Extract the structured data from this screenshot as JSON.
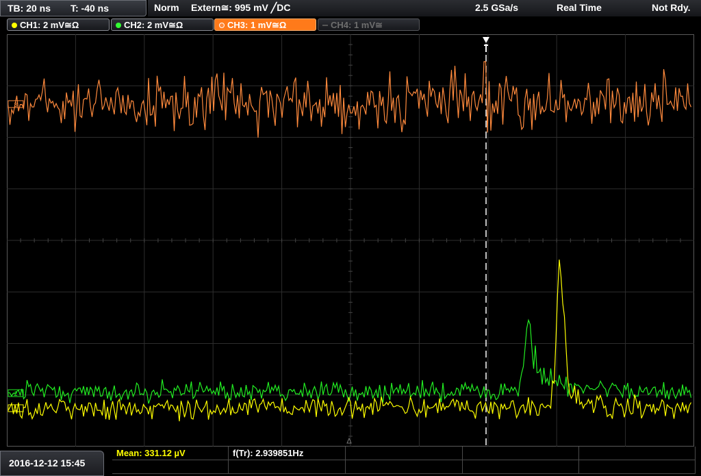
{
  "timebase": {
    "tb_label": "TB: 20 ns",
    "t_label": "T: -40 ns"
  },
  "status": {
    "mode": "Norm",
    "trigger": "Extern≅: 995 mV ╱DC",
    "sample_rate": "2.5 GSa/s",
    "acq_mode": "Real Time",
    "state": "Not Rdy."
  },
  "channels": [
    {
      "label": "CH1: 2 mV≅Ω",
      "color": "#ffff00",
      "active": false,
      "enabled": true
    },
    {
      "label": "CH2: 2 mV≅Ω",
      "color": "#33ff33",
      "active": false,
      "enabled": true
    },
    {
      "label": "CH3: 1 mV≅Ω",
      "color": "#ff8a3d",
      "active": true,
      "enabled": true
    },
    {
      "label": "CH4: 1 mV≅",
      "color": "#6e6e6e",
      "active": false,
      "enabled": false
    }
  ],
  "colors": {
    "ch1": "#ffff00",
    "ch2": "#22ee22",
    "ch3": "#ff8a3d",
    "grid": "#2e2e2e",
    "trigger_marker": "#ffffff"
  },
  "waveforms": {
    "ch3_offset_label": "3",
    "ch1_offset_label": "1",
    "ch2_offset_label": "2",
    "trigger_icon": "trigger-position-icon",
    "ground_icon": "ground-marker-icon"
  },
  "footer": {
    "datetime": "2016-12-12 15:45",
    "measurements": [
      {
        "label": "Mean: 331.12 µV",
        "color": "#ffff00"
      },
      {
        "label": "f(Tr): 2.939851Hz",
        "color": "#ffffff"
      }
    ]
  }
}
